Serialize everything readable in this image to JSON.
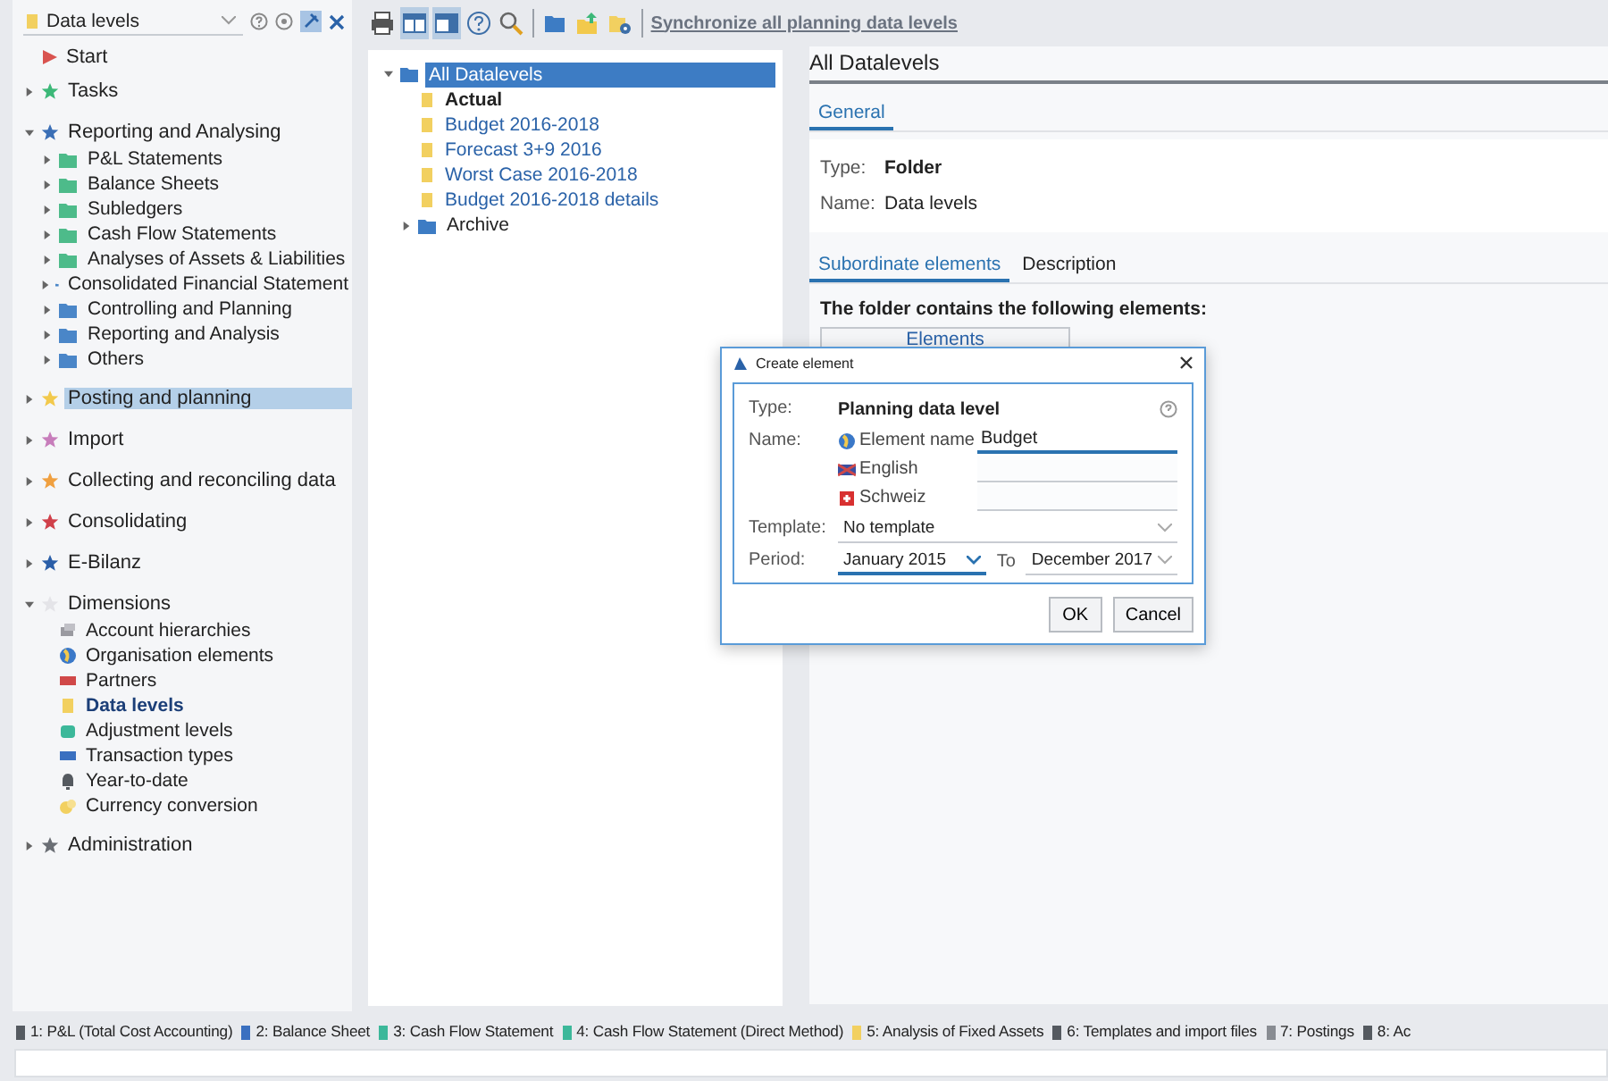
{
  "sidebar": {
    "selector": {
      "value": "Data levels"
    },
    "items": [
      {
        "label": "Start",
        "kind": "flag",
        "color": "#d9534f",
        "selected": false
      },
      {
        "label": "Tasks",
        "kind": "star",
        "color": "#3cb878",
        "expanded": false,
        "selected": false
      },
      {
        "label": "Reporting and Analysing",
        "kind": "star",
        "color": "#3b6fb6",
        "expanded": true,
        "selected": false,
        "children": [
          {
            "label": "P&L Statements",
            "kind": "folder",
            "color": "#4dbb8a",
            "expanded": false,
            "selected": false
          },
          {
            "label": "Balance Sheets",
            "kind": "folder",
            "color": "#4dbb8a",
            "expanded": false,
            "selected": false
          },
          {
            "label": "Subledgers",
            "kind": "folder",
            "color": "#4dbb8a",
            "expanded": false,
            "selected": false
          },
          {
            "label": "Cash Flow Statements",
            "kind": "folder",
            "color": "#4dbb8a",
            "expanded": false,
            "selected": false
          },
          {
            "label": "Analyses of Assets & Liabilities",
            "kind": "folder",
            "color": "#4dbb8a",
            "expanded": false,
            "selected": false
          },
          {
            "label": "Consolidated Financial Statement",
            "kind": "folder",
            "color": "#4a86c8",
            "expanded": false,
            "selected": false
          },
          {
            "label": "Controlling and Planning",
            "kind": "folder",
            "color": "#4a86c8",
            "expanded": false,
            "selected": false
          },
          {
            "label": "Reporting and Analysis",
            "kind": "folder",
            "color": "#4a86c8",
            "expanded": false,
            "selected": false
          },
          {
            "label": "Others",
            "kind": "folder",
            "color": "#4a86c8",
            "expanded": false,
            "selected": false
          }
        ]
      },
      {
        "label": "Posting and planning",
        "kind": "star",
        "color": "#f2c94c",
        "expanded": false,
        "selected": true
      },
      {
        "label": "Import",
        "kind": "star",
        "color": "#c77dbb",
        "expanded": false,
        "selected": false
      },
      {
        "label": "Collecting and reconciling data",
        "kind": "star",
        "color": "#f0a040",
        "expanded": false,
        "selected": false
      },
      {
        "label": "Consolidating",
        "kind": "star",
        "color": "#d0404a",
        "expanded": false,
        "selected": false
      },
      {
        "label": "E-Bilanz",
        "kind": "star",
        "color": "#2a5ea8",
        "expanded": false,
        "selected": false
      },
      {
        "label": "Dimensions",
        "kind": "star",
        "color": "#e4e4e8",
        "expanded": true,
        "selected": false,
        "children": [
          {
            "label": "Account hierarchies",
            "kind": "stack",
            "color": "#9a9aa0",
            "selected": false
          },
          {
            "label": "Organisation elements",
            "kind": "globe",
            "color": "#3a78c8",
            "selected": false
          },
          {
            "label": "Partners",
            "kind": "card",
            "color": "#d04848",
            "selected": false
          },
          {
            "label": "Data levels",
            "kind": "sheet",
            "color": "#f2d060",
            "selected": true
          },
          {
            "label": "Adjustment levels",
            "kind": "gem",
            "color": "#3cb89a",
            "selected": false
          },
          {
            "label": "Transaction types",
            "kind": "card",
            "color": "#3a70c0",
            "selected": false
          },
          {
            "label": "Year-to-date",
            "kind": "bell",
            "color": "#555a60",
            "selected": false
          },
          {
            "label": "Currency conversion",
            "kind": "coins",
            "color": "#f2d060",
            "selected": false
          }
        ]
      },
      {
        "label": "Administration",
        "kind": "star",
        "color": "#6a6e74",
        "expanded": false,
        "selected": false
      }
    ]
  },
  "toolbar": {
    "buttons": [
      {
        "kind": "print",
        "pressed": false
      },
      {
        "kind": "layout",
        "pressed": true
      },
      {
        "kind": "layout2",
        "pressed": true
      },
      {
        "kind": "help",
        "pressed": false
      },
      {
        "kind": "search",
        "pressed": false
      },
      {
        "kind": "folder",
        "pressed": false
      },
      {
        "kind": "upload",
        "pressed": false
      },
      {
        "kind": "settings",
        "pressed": false
      }
    ],
    "link": "Synchronize all planning data levels"
  },
  "tree": {
    "label": "All Datalevels",
    "selected": true,
    "expanded": true,
    "children": [
      {
        "label": "Actual",
        "kind": "level",
        "active": true,
        "selected": false
      },
      {
        "label": "Budget 2016-2018",
        "kind": "level",
        "active": false,
        "selected": false
      },
      {
        "label": "Forecast 3+9 2016",
        "kind": "level",
        "active": false,
        "selected": false
      },
      {
        "label": "Worst Case 2016-2018",
        "kind": "level",
        "active": false,
        "selected": false
      },
      {
        "label": "Budget 2016-2018 details",
        "kind": "level",
        "active": false,
        "selected": false
      },
      {
        "label": "Archive",
        "kind": "folder",
        "active": false,
        "selected": false,
        "expanded": false
      }
    ]
  },
  "details": {
    "title": "All Datalevels",
    "tabs": [
      {
        "label": "General",
        "selected": true
      }
    ],
    "fields": [
      {
        "label": "Type:",
        "value": "Folder",
        "bold": true
      },
      {
        "label": "Name:",
        "value": "Data levels",
        "bold": false
      }
    ],
    "subtabs": [
      {
        "label": "Subordinate elements",
        "selected": true
      },
      {
        "label": "Description",
        "selected": false
      }
    ],
    "intro": "The folder contains the following elements:",
    "table": {
      "columns": [
        "Elements"
      ]
    }
  },
  "dialog": {
    "title": "Create element",
    "type_label": "Type:",
    "type_value": "Planning data level",
    "name_label": "Name:",
    "names": [
      {
        "label": "Element name",
        "kind": "globe",
        "value": "Budget",
        "focused": true
      },
      {
        "label": "English",
        "kind": "flag-uk",
        "focused": false
      },
      {
        "label": "Schweiz",
        "kind": "flag-ch",
        "focused": false
      }
    ],
    "template_label": "Template:",
    "template_value": "No template",
    "period_label": "Period:",
    "period_from": "January 2015",
    "period_to_label": "To",
    "period_to": "December 2017",
    "buttons": [
      "OK",
      "Cancel"
    ]
  },
  "taskbar": [
    {
      "label": "1: P&L (Total Cost Accounting)",
      "color": "#555a60"
    },
    {
      "label": "2: Balance Sheet",
      "color": "#3a70c0"
    },
    {
      "label": "3: Cash Flow Statement",
      "color": "#3cb89a"
    },
    {
      "label": "4: Cash Flow Statement (Direct Method)",
      "color": "#3cb89a"
    },
    {
      "label": "5: Analysis of Fixed Assets",
      "color": "#f2d060"
    },
    {
      "label": "6: Templates and import files",
      "color": "#555a60"
    },
    {
      "label": "7: Postings",
      "color": "#888c92"
    },
    {
      "label": "8: Ac",
      "color": "#555a60"
    }
  ]
}
